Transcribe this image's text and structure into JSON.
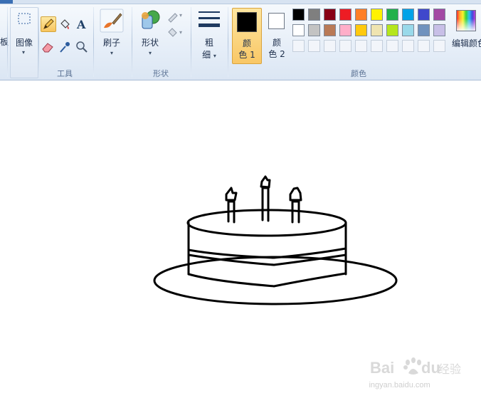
{
  "ribbon": {
    "clipboard_fragment": "板",
    "image_label": "图像",
    "tools_label": "工具",
    "brushes_label": "刷子",
    "shapes_label": "形状",
    "shapes_group_label": "形状",
    "size_label_line1": "粗",
    "size_label_line2": "细",
    "color1_line1": "颜",
    "color1_line2": "色 1",
    "color2_line1": "颜",
    "color2_line2": "色 2",
    "colors_group_label": "颜色",
    "edit_colors_label": "编辑颜色",
    "color1_value": "#000000",
    "color2_value": "#ffffff"
  },
  "palette": {
    "row1": [
      "#000000",
      "#7f7f7f",
      "#880015",
      "#ed1c24",
      "#ff7f27",
      "#fff200",
      "#22b14c",
      "#00a2e8",
      "#3f48cc",
      "#a349a4"
    ],
    "row2": [
      "#ffffff",
      "#c3c3c3",
      "#b97a57",
      "#ffaec9",
      "#ffc90e",
      "#efe4b0",
      "#b5e61d",
      "#99d9ea",
      "#7092be",
      "#c8bfe7"
    ]
  },
  "watermark": {
    "brand": "Baidu",
    "brand_cn": "经验",
    "url": "jingyan.baidu.com"
  }
}
